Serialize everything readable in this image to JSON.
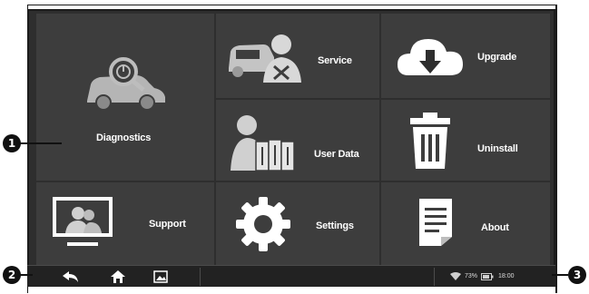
{
  "tiles": {
    "diagnostics": {
      "label": "Diagnostics",
      "icon": "car-search-icon"
    },
    "service": {
      "label": "Service",
      "icon": "car-technician-icon"
    },
    "upgrade": {
      "label": "Upgrade",
      "icon": "cloud-download-icon"
    },
    "user_data": {
      "label": "User Data",
      "icon": "user-files-icon"
    },
    "uninstall": {
      "label": "Uninstall",
      "icon": "trash-icon"
    },
    "support": {
      "label": "Support",
      "icon": "support-monitor-icon"
    },
    "settings": {
      "label": "Settings",
      "icon": "gear-icon"
    },
    "about": {
      "label": "About",
      "icon": "document-icon"
    }
  },
  "taskbar": {
    "nav_icons": [
      "back-icon",
      "home-icon",
      "recent-apps-icon"
    ],
    "status": {
      "battery_percent": "73%",
      "time": "18:00"
    }
  },
  "callouts": {
    "one": "1",
    "two": "2",
    "three": "3"
  },
  "colors": {
    "tile_bg": "#3d3d3d",
    "screen_bg": "#2e2e2e",
    "icon_light": "#d0d0d0"
  }
}
